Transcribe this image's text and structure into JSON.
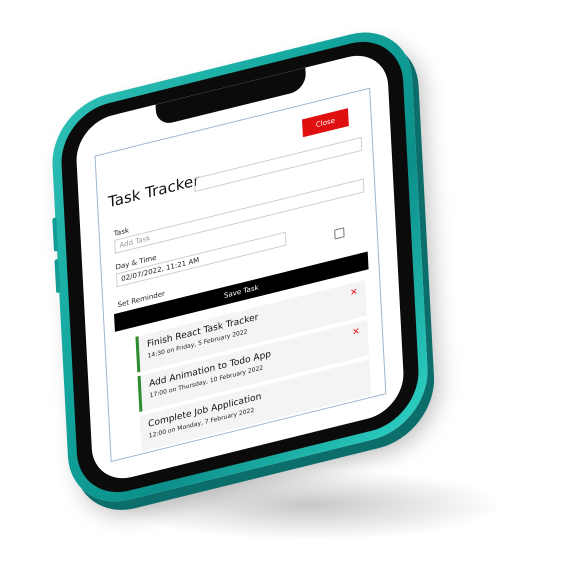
{
  "app": {
    "title": "Task Tracker",
    "close_label": "Close"
  },
  "form": {
    "task_label": "Task",
    "task_placeholder": "Add Task",
    "datetime_label": "Day & Time",
    "datetime_value": "02/07/2022, 11:21 AM",
    "reminder_label": "Set Reminder",
    "save_label": "Save Task"
  },
  "tasks": [
    {
      "title": "Finish React Task Tracker",
      "date": "14:30 on Friday, 5 February 2022",
      "reminder": true
    },
    {
      "title": "Add Animation to Todo App",
      "date": "17:00 on Thursday, 10 February 2022",
      "reminder": true
    },
    {
      "title": "Complete Job Application",
      "date": "12:00 on Monday, 7 February 2022",
      "reminder": false
    }
  ],
  "icons": {
    "delete": "close-x-icon"
  },
  "colors": {
    "phone_frame": "#13a79f",
    "close_button": "#e01010",
    "save_button": "#000000",
    "reminder_border": "#2e8b2e",
    "delete_icon": "#e01010"
  }
}
